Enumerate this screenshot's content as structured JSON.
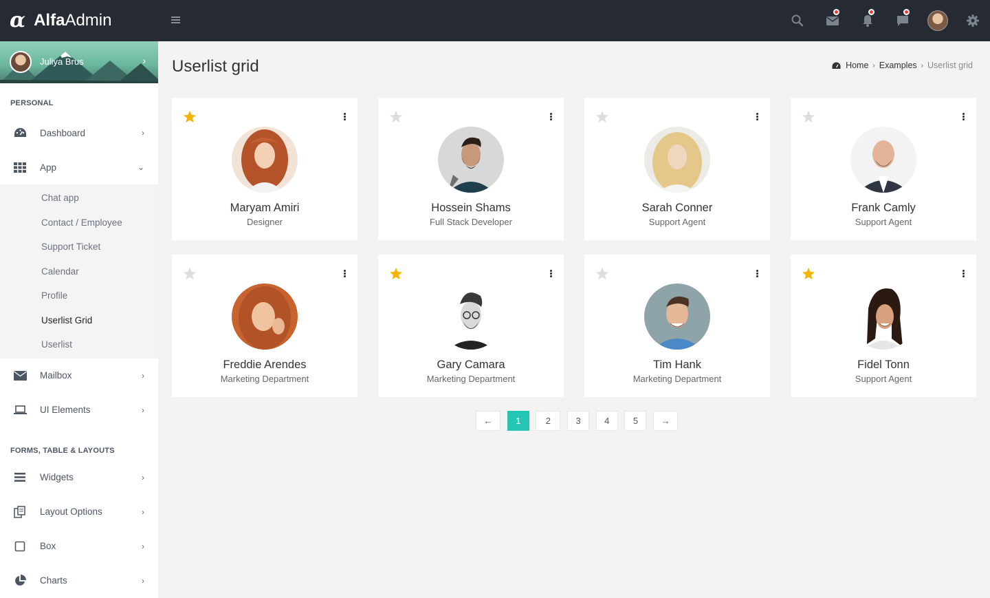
{
  "brand": {
    "logo": "α",
    "name_bold": "Alfa",
    "name_light": "Admin"
  },
  "topbar": {
    "icons": [
      "menu-icon",
      "search-icon",
      "mail-icon",
      "bell-icon",
      "chat-icon",
      "avatar",
      "gear-icon"
    ],
    "notification_dot_color": "#ee3b3b"
  },
  "sidebar": {
    "user_name": "Juliya Brus",
    "sections": {
      "personal": "PERSONAL",
      "forms": "FORMS, TABLE & LAYOUTS"
    },
    "menu": {
      "dashboard": "Dashboard",
      "app": "App",
      "mailbox": "Mailbox",
      "ui_elements": "UI Elements",
      "widgets": "Widgets",
      "layout_options": "Layout Options",
      "box": "Box",
      "charts": "Charts"
    },
    "app_submenu": [
      "Chat app",
      "Contact / Employee",
      "Support Ticket",
      "Calendar",
      "Profile",
      "Userlist Grid",
      "Userlist"
    ],
    "active_subitem": "Userlist Grid"
  },
  "page": {
    "title": "Userlist grid",
    "breadcrumb": [
      "Home",
      "Examples",
      "Userlist grid"
    ]
  },
  "users": [
    {
      "name": "Maryam Amiri",
      "role": "Designer",
      "starred": true
    },
    {
      "name": "Hossein Shams",
      "role": "Full Stack Developer",
      "starred": false
    },
    {
      "name": "Sarah Conner",
      "role": "Support Agent",
      "starred": false
    },
    {
      "name": "Frank Camly",
      "role": "Support Agent",
      "starred": false
    },
    {
      "name": "Freddie Arendes",
      "role": "Marketing Department",
      "starred": false
    },
    {
      "name": "Gary Camara",
      "role": "Marketing Department",
      "starred": true
    },
    {
      "name": "Tim Hank",
      "role": "Marketing Department",
      "starred": false
    },
    {
      "name": "Fidel Tonn",
      "role": "Support Agent",
      "starred": true
    }
  ],
  "pagination": {
    "prev": "←",
    "pages": [
      "1",
      "2",
      "3",
      "4",
      "5"
    ],
    "next": "→",
    "current": "1"
  },
  "colors": {
    "accent": "#26c6b5",
    "star_on": "#f5b400",
    "star_off": "#dddddd",
    "topbar": "#252a33"
  }
}
